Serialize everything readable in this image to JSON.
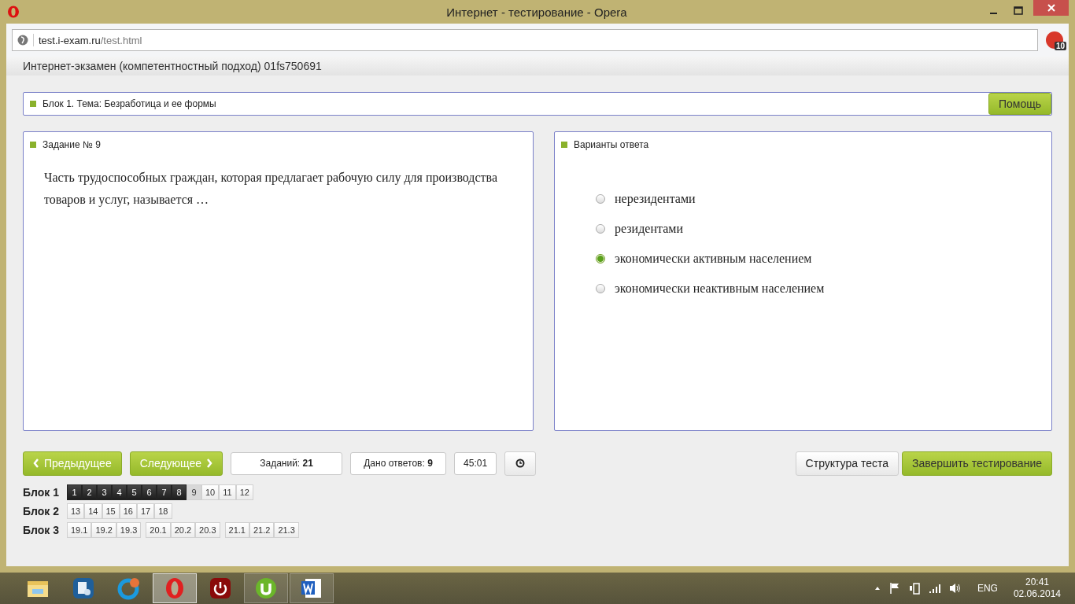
{
  "window": {
    "title": "Интернет - тестирование - Opera"
  },
  "browser": {
    "url_host": "test.i-exam.ru",
    "url_path": "/test.html",
    "addon_badge": "10"
  },
  "page_header": "Интернет-экзамен (компетентностный подход) 01fs750691",
  "block_bar": {
    "title": "Блок 1. Тема: Безработица и ее формы",
    "help_button": "Помощь"
  },
  "task": {
    "title": "Задание № 9",
    "text": "Часть трудоспособных граждан, которая предлагает рабочую силу для производства товаров и услуг, называется …"
  },
  "answers": {
    "title": "Варианты ответа",
    "options": [
      {
        "label": "нерезидентами",
        "selected": false
      },
      {
        "label": "резидентами",
        "selected": false
      },
      {
        "label": "экономически активным населением",
        "selected": true
      },
      {
        "label": "экономически неактивным населением",
        "selected": false
      }
    ]
  },
  "controls": {
    "prev": "Предыдущее",
    "next": "Следующее",
    "tasks_label": "Заданий:",
    "tasks_value": "21",
    "answered_label": "Дано ответов:",
    "answered_value": "9",
    "timer": "45:01",
    "structure": "Структура теста",
    "finish": "Завершить тестирование"
  },
  "blocks": [
    {
      "label": "Блок 1",
      "groups": [
        [
          {
            "n": "1",
            "answered": true,
            "selected": false
          },
          {
            "n": "2",
            "answered": true,
            "selected": false
          },
          {
            "n": "3",
            "answered": true,
            "selected": false
          },
          {
            "n": "4",
            "answered": true,
            "selected": false
          },
          {
            "n": "5",
            "answered": true,
            "selected": false
          },
          {
            "n": "6",
            "answered": true,
            "selected": false
          },
          {
            "n": "7",
            "answered": true,
            "selected": false
          },
          {
            "n": "8",
            "answered": true,
            "selected": false
          },
          {
            "n": "9",
            "answered": false,
            "selected": true
          },
          {
            "n": "10",
            "answered": false,
            "selected": false
          },
          {
            "n": "11",
            "answered": false,
            "selected": false
          },
          {
            "n": "12",
            "answered": false,
            "selected": false
          }
        ]
      ]
    },
    {
      "label": "Блок 2",
      "groups": [
        [
          {
            "n": "13",
            "answered": false,
            "selected": false
          },
          {
            "n": "14",
            "answered": false,
            "selected": false
          },
          {
            "n": "15",
            "answered": false,
            "selected": false
          },
          {
            "n": "16",
            "answered": false,
            "selected": false
          },
          {
            "n": "17",
            "answered": false,
            "selected": false
          },
          {
            "n": "18",
            "answered": false,
            "selected": false
          }
        ]
      ]
    },
    {
      "label": "Блок 3",
      "groups": [
        [
          {
            "n": "19.1",
            "answered": false,
            "selected": false
          },
          {
            "n": "19.2",
            "answered": false,
            "selected": false
          },
          {
            "n": "19.3",
            "answered": false,
            "selected": false
          }
        ],
        [
          {
            "n": "20.1",
            "answered": false,
            "selected": false
          },
          {
            "n": "20.2",
            "answered": false,
            "selected": false
          },
          {
            "n": "20.3",
            "answered": false,
            "selected": false
          }
        ],
        [
          {
            "n": "21.1",
            "answered": false,
            "selected": false
          },
          {
            "n": "21.2",
            "answered": false,
            "selected": false
          },
          {
            "n": "21.3",
            "answered": false,
            "selected": false
          }
        ]
      ]
    }
  ],
  "taskbar": {
    "apps": [
      {
        "kind": "folder",
        "selected": false,
        "running": false
      },
      {
        "kind": "settings",
        "selected": false,
        "running": false
      },
      {
        "kind": "chat",
        "selected": false,
        "running": false
      },
      {
        "kind": "opera",
        "selected": true,
        "running": true
      },
      {
        "kind": "power",
        "selected": false,
        "running": false
      },
      {
        "kind": "torrent",
        "selected": false,
        "running": true
      },
      {
        "kind": "word",
        "selected": false,
        "running": true
      }
    ],
    "language": "ENG",
    "time": "20:41",
    "date": "02.06.2014"
  }
}
